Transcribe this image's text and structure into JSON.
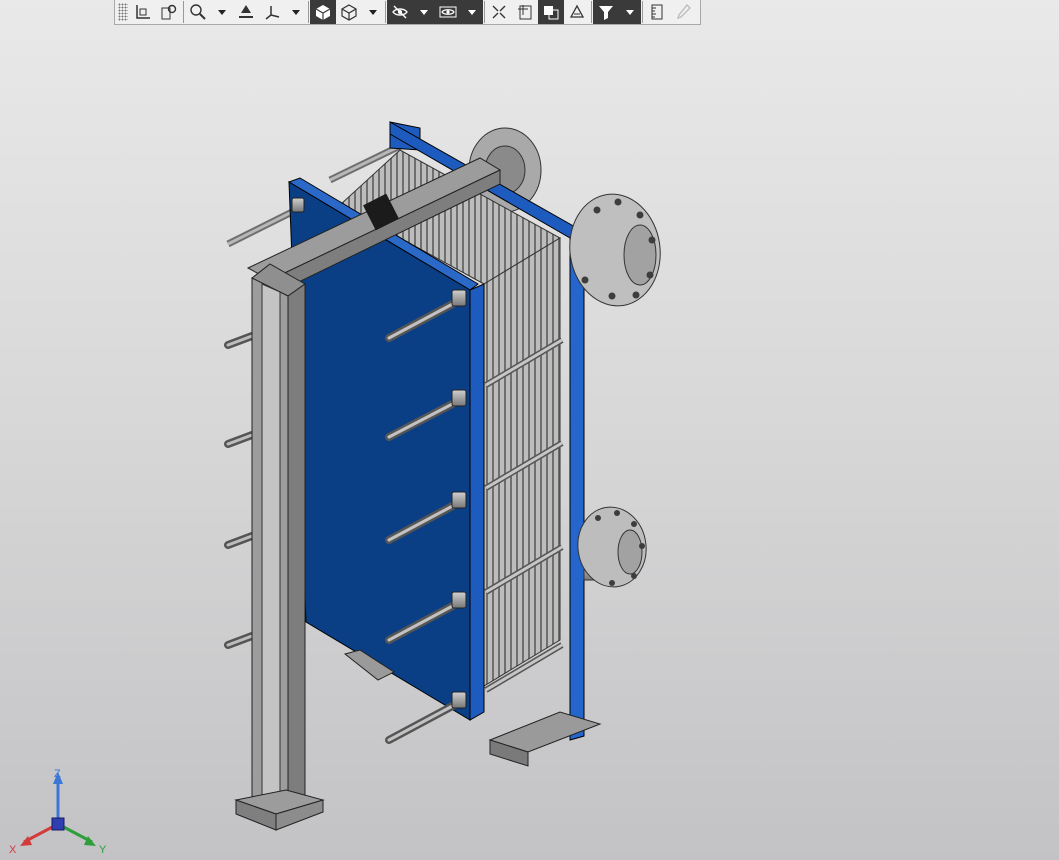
{
  "toolbar": {
    "buttons": [
      {
        "icon": "grip-icon"
      },
      {
        "icon": "orient-axes-icon"
      },
      {
        "icon": "view-zoom-region-icon"
      },
      {
        "icon": "zoom-icon"
      },
      {
        "icon": "dropdown-icon"
      },
      {
        "icon": "rotate-icon"
      },
      {
        "icon": "orientation-icon"
      },
      {
        "icon": "dropdown-icon"
      },
      {
        "icon": "shaded-cube-icon"
      },
      {
        "icon": "wireframe-cube-icon"
      },
      {
        "icon": "dropdown-icon"
      },
      {
        "icon": "hide-icon"
      },
      {
        "icon": "dropdown-icon"
      },
      {
        "icon": "show-icon"
      },
      {
        "icon": "dropdown-icon"
      },
      {
        "icon": "section-icon"
      },
      {
        "icon": "clip-icon"
      },
      {
        "icon": "layers-icon"
      },
      {
        "icon": "display-style-icon"
      },
      {
        "icon": "filter-icon"
      },
      {
        "icon": "dropdown-icon"
      },
      {
        "icon": "measure-icon"
      },
      {
        "icon": "eyedropper-icon"
      }
    ]
  },
  "triad": {
    "x_label": "X",
    "y_label": "Y",
    "z_label": "Z"
  },
  "colors": {
    "frame_blue": "#1d5bbf",
    "plate_blue": "#0a3f86",
    "steel": "#a8a8a8",
    "axis_x": "#d23b3b",
    "axis_y": "#2e9e3a",
    "axis_z": "#3a77d6"
  }
}
